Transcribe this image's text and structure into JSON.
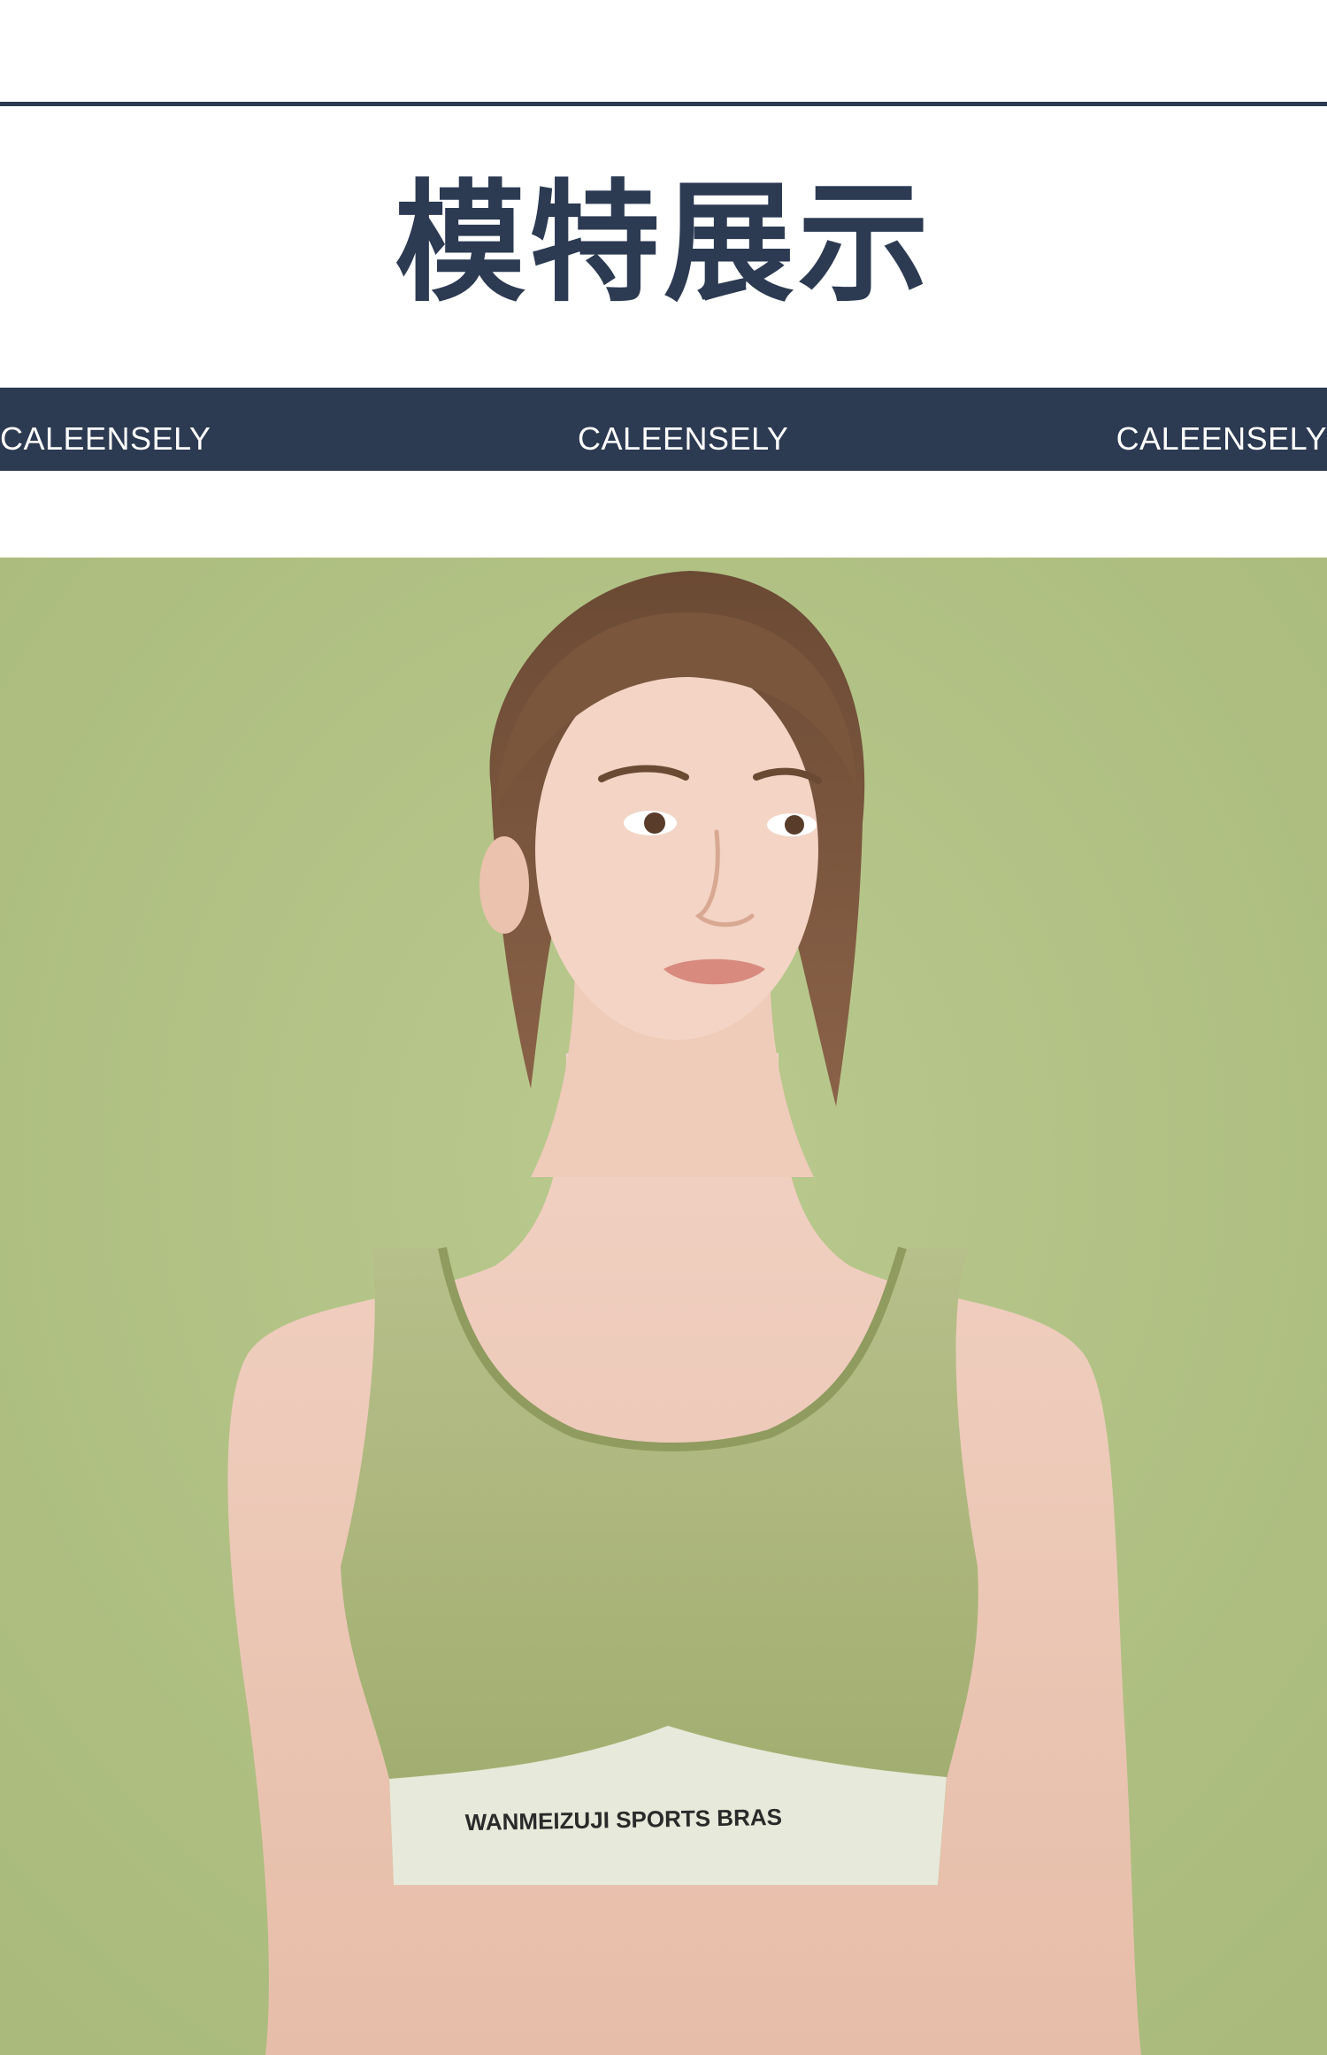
{
  "header": {
    "title": "模特展示"
  },
  "brand_band": {
    "items": [
      "CALEENSELY",
      "CALEENSELY",
      "CALEENSELY"
    ]
  },
  "photo": {
    "bra_print": "WANMEIZUJI SPORTS BRAS",
    "background_color": "#b2c285",
    "garment_color": "#a9b57a",
    "band_color": "#e7e9da"
  },
  "colors": {
    "navy": "#2c3a52",
    "white": "#ffffff"
  }
}
